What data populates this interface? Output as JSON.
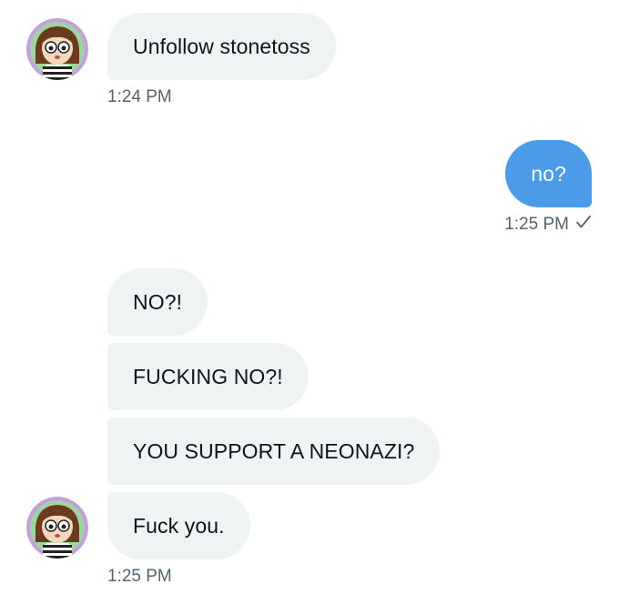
{
  "messages": [
    {
      "direction": "incoming",
      "text": "Unfollow stonetoss",
      "time": "1:24 PM"
    },
    {
      "direction": "outgoing",
      "text": "no?",
      "time": "1:25 PM",
      "status_icon": "check-icon"
    },
    {
      "direction": "incoming",
      "text": "NO?!"
    },
    {
      "direction": "incoming",
      "text": "FUCKING NO?!"
    },
    {
      "direction": "incoming",
      "text": "YOU SUPPORT A NEONAZI?"
    },
    {
      "direction": "incoming",
      "text": "Fuck you.",
      "time": "1:25 PM"
    }
  ],
  "colors": {
    "incoming_bubble": "#eff3f4",
    "outgoing_bubble": "#4c9be8",
    "timestamp": "#536471",
    "text": "#0f1419"
  }
}
